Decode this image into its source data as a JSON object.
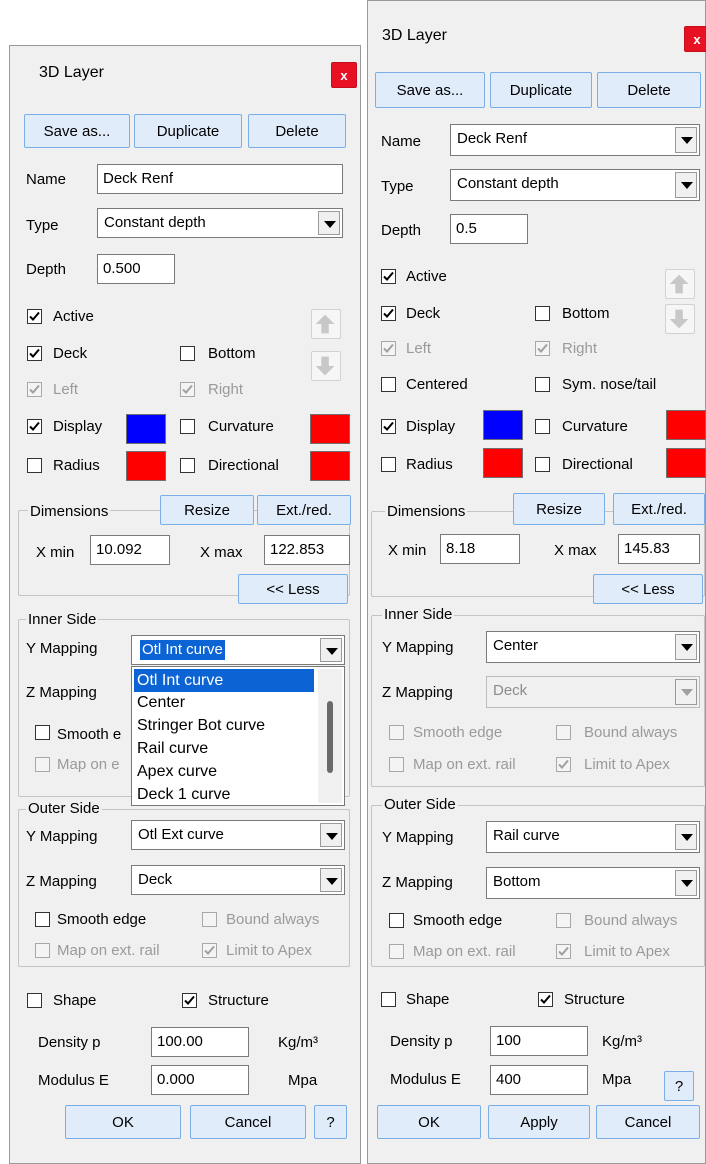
{
  "left": {
    "title": "3D Layer",
    "close": "x",
    "buttons": {
      "save_as": "Save as...",
      "duplicate": "Duplicate",
      "delete": "Delete"
    },
    "name_label": "Name",
    "name_value": "Deck Renf",
    "type_label": "Type",
    "type_value": "Constant depth",
    "depth_label": "Depth",
    "depth_value": "0.500",
    "active": "Active",
    "deck": "Deck",
    "bottom": "Bottom",
    "left_side": "Left",
    "right_side": "Right",
    "display": "Display",
    "curvature": "Curvature",
    "radius": "Radius",
    "directional": "Directional",
    "dimensions": "Dimensions",
    "resize": "Resize",
    "ext_red": "Ext./red.",
    "xmin_label": "X min",
    "xmin_value": "10.092",
    "xmax_label": "X max",
    "xmax_value": "122.853",
    "less": "<< Less",
    "inner_side": "Inner Side",
    "y_mapping": "Y Mapping",
    "inner_y_value": "Otl Int curve",
    "z_mapping": "Z Mapping",
    "smooth_edge_partial": "Smooth e",
    "map_ext_partial": "Map on e",
    "dropdown_options": [
      "Otl Int curve",
      "Center",
      "Stringer Bot curve",
      "Rail curve",
      "Apex curve",
      "Deck 1 curve"
    ],
    "outer_side": "Outer Side",
    "outer_y_value": "Otl Ext curve",
    "outer_z_value": "Deck",
    "smooth_edge": "Smooth edge",
    "bound_always": "Bound always",
    "map_ext_rail": "Map on ext. rail",
    "limit_apex": "Limit to Apex",
    "shape": "Shape",
    "structure": "Structure",
    "density_label": "Density p",
    "density_value": "100.00",
    "density_unit": "Kg/m³",
    "modulus_label": "Modulus E",
    "modulus_value": "0.000",
    "modulus_unit": "Mpa",
    "ok": "OK",
    "cancel": "Cancel",
    "help": "?"
  },
  "right": {
    "title": "3D Layer",
    "close": "x",
    "buttons": {
      "save_as": "Save as...",
      "duplicate": "Duplicate",
      "delete": "Delete"
    },
    "name_label": "Name",
    "name_value": "Deck Renf",
    "type_label": "Type",
    "type_value": "Constant depth",
    "depth_label": "Depth",
    "depth_value": "0.5",
    "active": "Active",
    "deck": "Deck",
    "bottom": "Bottom",
    "left_side": "Left",
    "right_side": "Right",
    "centered": "Centered",
    "sym_nose_tail": "Sym. nose/tail",
    "display": "Display",
    "curvature": "Curvature",
    "radius": "Radius",
    "directional": "Directional",
    "dimensions": "Dimensions",
    "resize": "Resize",
    "ext_red": "Ext./red.",
    "xmin_label": "X min",
    "xmin_value": "8.18",
    "xmax_label": "X max",
    "xmax_value": "145.83",
    "less": "<< Less",
    "inner_side": "Inner Side",
    "y_mapping": "Y Mapping",
    "inner_y_value": "Center",
    "z_mapping": "Z Mapping",
    "inner_z_value": "Deck",
    "smooth_edge": "Smooth edge",
    "bound_always": "Bound always",
    "map_ext_rail": "Map on ext. rail",
    "limit_apex": "Limit to Apex",
    "outer_side": "Outer Side",
    "outer_y_value": "Rail curve",
    "outer_z_value": "Bottom",
    "shape": "Shape",
    "structure": "Structure",
    "density_label": "Density p",
    "density_value": "100",
    "density_unit": "Kg/m³",
    "modulus_label": "Modulus E",
    "modulus_value": "400",
    "modulus_unit": "Mpa",
    "ok": "OK",
    "apply": "Apply",
    "cancel": "Cancel",
    "help": "?"
  },
  "colors": {
    "display_swatch": "#0000ff",
    "curvature_swatch": "#ff0000",
    "radius_swatch": "#ff0000",
    "directional_swatch": "#ff0000",
    "close_bg": "#e81123",
    "selection": "#0b63d4"
  }
}
